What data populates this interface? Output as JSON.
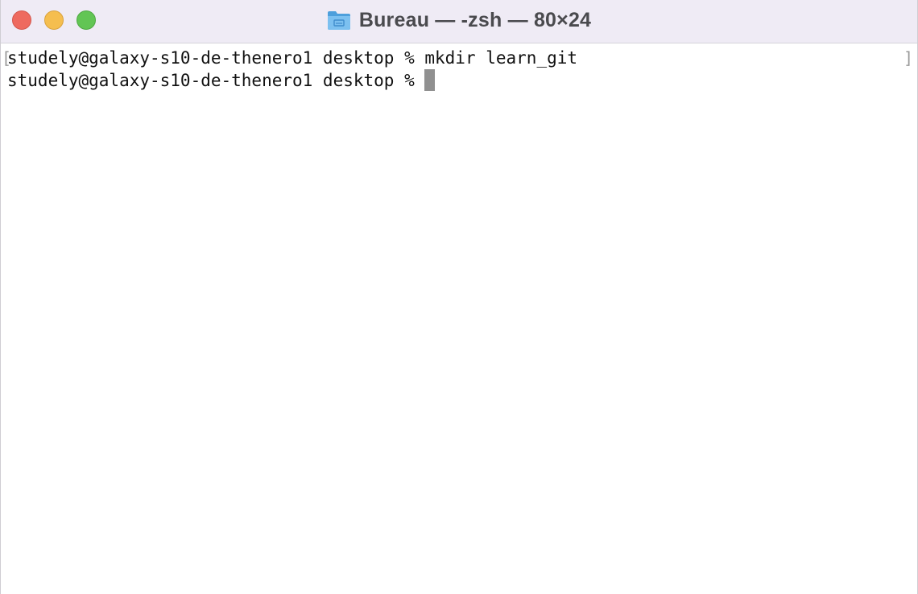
{
  "window": {
    "title": "Bureau — -zsh — 80×24",
    "title_icon": "folder-icon",
    "controls": [
      "close",
      "minimize",
      "zoom"
    ]
  },
  "terminal": {
    "mark_left": "[",
    "mark_right": "]",
    "lines": [
      {
        "prompt": "studely@galaxy-s10-de-thenero1 desktop % ",
        "command": "mkdir learn_git"
      },
      {
        "prompt": "studely@galaxy-s10-de-thenero1 desktop % ",
        "command": ""
      }
    ]
  },
  "colors": {
    "titlebar": "#efebf5",
    "close": "#ee6a5f",
    "minimize": "#f5be4f",
    "zoom": "#62c554",
    "cursor": "#909090",
    "folder": "#5aa7e0"
  }
}
